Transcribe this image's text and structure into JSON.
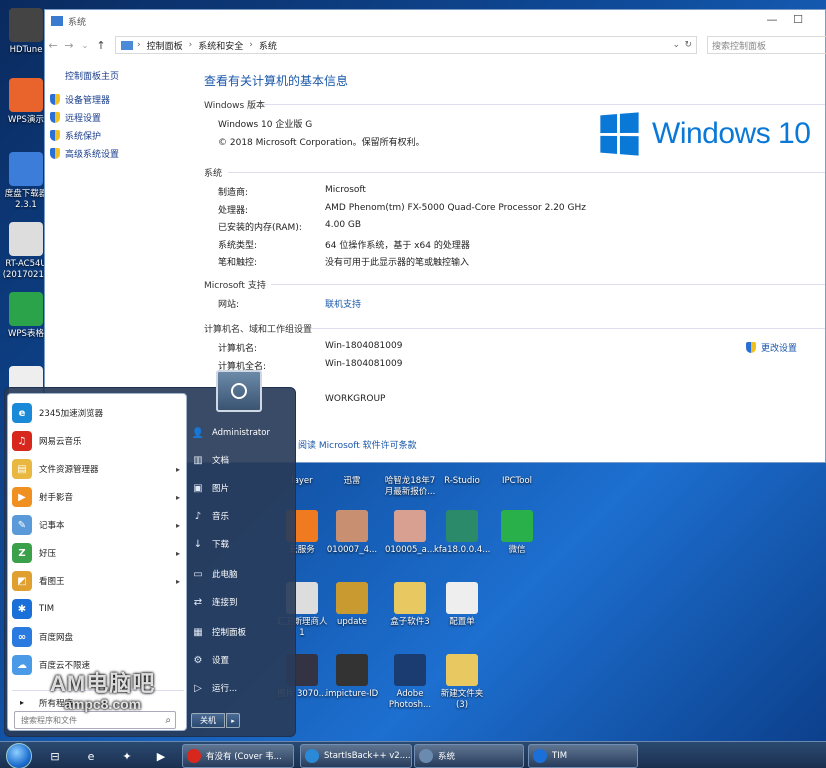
{
  "desktop_left": [
    {
      "label": "HDTune",
      "color": "#444"
    },
    {
      "label": "WPS演示",
      "color": "#e8642c"
    },
    {
      "label": "度盘下载器 2.3.1",
      "color": "#3b7dd8"
    },
    {
      "label": "RT-AC54U (20170211",
      "color": "#ddd"
    },
    {
      "label": "WPS表格",
      "color": "#2aa34a"
    }
  ],
  "desktop_right": [
    {
      "label": "layer",
      "color": "#555"
    },
    {
      "label": "迅雷",
      "color": "#4a8bd8"
    },
    {
      "label": "哈智龙18年7月最新报价...",
      "color": "#eee"
    },
    {
      "label": "R-Studio",
      "color": "#3a6fbf"
    },
    {
      "label": "IPCTool",
      "color": "#2a5aa0"
    },
    {
      "label": "云服务",
      "color": "#f07a20"
    },
    {
      "label": "010007_4...",
      "color": "#c89070"
    },
    {
      "label": "010005_a...",
      "color": "#d8a090"
    },
    {
      "label": "kfa18.0.0.4...",
      "color": "#2a8a6a"
    },
    {
      "label": "微信",
      "color": "#2ab04a"
    },
    {
      "label": "汇卫斯理商人1",
      "color": "#ddd"
    },
    {
      "label": "update",
      "color": "#c89a30"
    },
    {
      "label": "盒子软件3",
      "color": "#e8c860"
    },
    {
      "label": "配置单",
      "color": "#eee"
    },
    {
      "label": "图片 3070...",
      "color": "#334"
    },
    {
      "label": "impicture-ID",
      "color": "#333"
    },
    {
      "label": "Adobe Photosh...",
      "color": "#1a3c70"
    },
    {
      "label": "新建文件夹 (3)",
      "color": "#e8c860"
    }
  ],
  "window": {
    "title": "系统",
    "minimize": "—",
    "maximize": "☐",
    "breadcrumb": [
      "控制面板",
      "系统和安全",
      "系统"
    ],
    "search_placeholder": "搜索控制面板",
    "left_home": "控制面板主页",
    "left_items": [
      "设备管理器",
      "远程设置",
      "系统保护",
      "高级系统设置"
    ],
    "heading": "查看有关计算机的基本信息",
    "edition_section": "Windows 版本",
    "edition": "Windows 10 企业版 G",
    "copyright": "© 2018 Microsoft Corporation。保留所有权利。",
    "logo_text": "Windows 10",
    "system_section": "系统",
    "system_rows": [
      {
        "k": "制造商:",
        "v": "Microsoft"
      },
      {
        "k": "处理器:",
        "v": "AMD Phenom(tm) FX-5000 Quad-Core Processor   2.20 GHz"
      },
      {
        "k": "已安装的内存(RAM):",
        "v": "4.00 GB"
      },
      {
        "k": "系统类型:",
        "v": "64 位操作系统，基于 x64 的处理器"
      },
      {
        "k": "笔和触控:",
        "v": "没有可用于此显示器的笔或触控输入"
      }
    ],
    "support_section": "Microsoft 支持",
    "website_key": "网站:",
    "website_val": "联机支持",
    "computer_section": "计算机名、域和工作组设置",
    "computer_rows": [
      {
        "k": "计算机名:",
        "v": "Win-1804081009"
      },
      {
        "k": "计算机全名:",
        "v": "Win-1804081009"
      }
    ],
    "change_settings": "更改设置",
    "workgroup": "WORKGROUP",
    "license_link": "阅读 Microsoft 软件许可条款"
  },
  "start_menu": {
    "programs": [
      {
        "label": "2345加速浏览器",
        "color": "#1a8ad8",
        "glyph": "e",
        "arrow": false
      },
      {
        "label": "网易云音乐",
        "color": "#d8281e",
        "glyph": "♫",
        "arrow": false
      },
      {
        "label": "文件资源管理器",
        "color": "#e8b840",
        "glyph": "▤",
        "arrow": true
      },
      {
        "label": "射手影音",
        "color": "#f09020",
        "glyph": "▶",
        "arrow": true
      },
      {
        "label": "记事本",
        "color": "#5a9ad8",
        "glyph": "✎",
        "arrow": true
      },
      {
        "label": "好压",
        "color": "#3aa04a",
        "glyph": "Z",
        "arrow": true
      },
      {
        "label": "看图王",
        "color": "#e0a030",
        "glyph": "◩",
        "arrow": true
      },
      {
        "label": "TIM",
        "color": "#1a6fd8",
        "glyph": "✱",
        "arrow": false
      },
      {
        "label": "百度网盘",
        "color": "#2a7ae0",
        "glyph": "∞",
        "arrow": false
      },
      {
        "label": "百度云不限速",
        "color": "#4a9ae8",
        "glyph": "☁",
        "arrow": false
      }
    ],
    "all_programs": "所有程序",
    "search_placeholder": "搜索程序和文件",
    "right": [
      {
        "label": "Administrator",
        "glyph": "👤"
      },
      {
        "label": "文档",
        "glyph": "▥"
      },
      {
        "label": "图片",
        "glyph": "▣"
      },
      {
        "label": "音乐",
        "glyph": "♪"
      },
      {
        "label": "下载",
        "glyph": "↓"
      },
      {
        "label": "此电脑",
        "glyph": "▭"
      },
      {
        "label": "连接到",
        "glyph": "⇄"
      },
      {
        "label": "控制面板",
        "glyph": "▦"
      },
      {
        "label": "设置",
        "glyph": "⚙"
      },
      {
        "label": "运行...",
        "glyph": "▷"
      }
    ],
    "shutdown": "关机",
    "shutdown_arrow": "▸"
  },
  "watermark": {
    "line1": "AM电脑吧",
    "line2": "ampc8.com"
  },
  "taskbar": {
    "pinned": [
      {
        "name": "task-view-icon",
        "glyph": "⊟"
      },
      {
        "name": "ie-icon",
        "glyph": "e"
      },
      {
        "name": "app-icon",
        "glyph": "✦"
      },
      {
        "name": "media-icon",
        "glyph": "▶"
      }
    ],
    "buttons": [
      {
        "label": "有没有 (Cover 韦...",
        "color": "#d8281e"
      },
      {
        "label": "StartIsBack++ v2....",
        "color": "#2a8ad8"
      },
      {
        "label": "系统",
        "color": "#6a8ab0"
      },
      {
        "label": "TIM",
        "color": "#1a6fd8"
      }
    ]
  }
}
